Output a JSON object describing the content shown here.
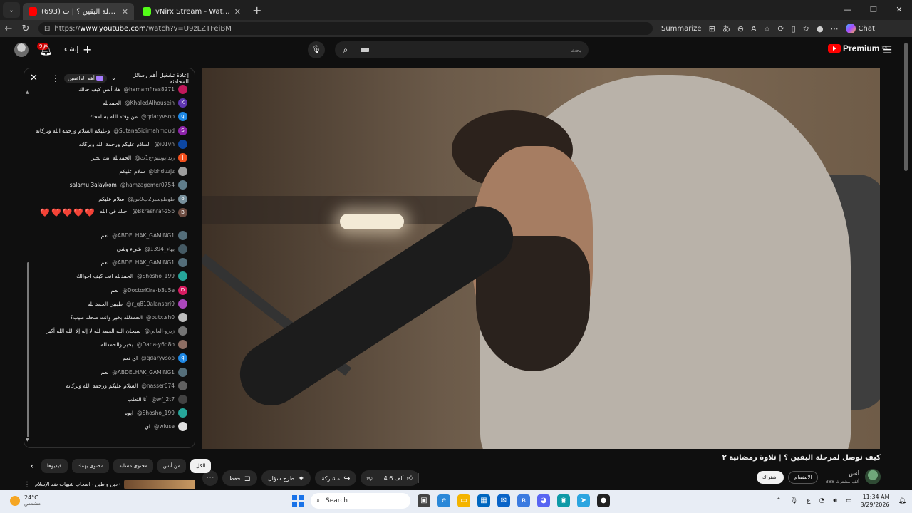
{
  "browser": {
    "tabs": [
      {
        "title": "(693) كيف توصل لمرحلة اليقين ؟ | ت",
        "favicon_color": "#ff0000",
        "active": true
      },
      {
        "title": "vNirx Stream - Watch Live on Kick",
        "favicon_color": "#53fc18",
        "active": false
      }
    ],
    "new_tab": "+",
    "url_prefix": "https://",
    "url_host": "www.youtube.com",
    "url_path": "/watch?v=U9zLZTFeiBM",
    "summarize_label": "Summarize",
    "chat_label": "Chat"
  },
  "youtube": {
    "notif_count": "9+",
    "create_label": "إنشاء",
    "search_placeholder": "بحث",
    "premium_label": "Premium",
    "region": "SA"
  },
  "chat": {
    "header_title": "إعادة تشغيل أهم رسائل المحادثة",
    "top_fans_label": "أهم الداعمين",
    "messages": [
      {
        "author": "@hamamfiras8271",
        "text": "هلا أنس كيف حالك",
        "avatar_color": "#c2185b",
        "initial": ""
      },
      {
        "author": "@KhaledAlhousein",
        "text": "الحمدلله",
        "avatar_color": "#5e35b1",
        "initial": "K"
      },
      {
        "author": "@qdaryvsop",
        "text": "من وقته الله يسامحك",
        "avatar_color": "#1e88e5",
        "initial": "q"
      },
      {
        "author": "@SutanaSidimahmoud",
        "text": "وعليكم السلام ورحمة الله وبركاته",
        "avatar_color": "#8e24aa",
        "initial": "S"
      },
      {
        "author": "@i01vn",
        "text": "السلام عليكم ورحمة الله وبركاته",
        "avatar_color": "#0d47a1",
        "initial": ""
      },
      {
        "author": "@زيدابويتيم-ع1ت",
        "text": "الحمدلله انت بخير",
        "avatar_color": "#f4511e",
        "initial": "J"
      },
      {
        "author": "@bhduzjz",
        "text": "سلام عليكم",
        "avatar_color": "#9e9e9e",
        "initial": ""
      },
      {
        "author": "@hamzagemer0754",
        "text": "salamu 3alaykom",
        "avatar_color": "#607d8b",
        "initial": ""
      },
      {
        "author": "@طوطوسبر2ب9س",
        "text": "سلام عليكم",
        "avatar_color": "#78909c",
        "initial": "o"
      },
      {
        "author": "@Bkrashraf-z5b",
        "text": "احبك في الله",
        "avatar_color": "#6d4c41",
        "initial": "B",
        "hearts": "❤️❤️❤️❤️❤️"
      },
      {
        "author": "@ABDELHAK_GAMING1",
        "text": "نعم",
        "avatar_color": "#546e7a",
        "initial": ""
      },
      {
        "author": "@بهاء_1394",
        "text": "شيء وشي",
        "avatar_color": "#455a64",
        "initial": ""
      },
      {
        "author": "@ABDELHAK_GAMING1",
        "text": "نعم",
        "avatar_color": "#546e7a",
        "initial": ""
      },
      {
        "author": "@Shosho_199",
        "text": "الحمدلله انت كيف احوالك",
        "avatar_color": "#26a69a",
        "initial": ""
      },
      {
        "author": "@DoctorKira-b3u5e",
        "text": "نعم",
        "avatar_color": "#d81b60",
        "initial": "D"
      },
      {
        "author": "@r_q810alansari9",
        "text": "طيبين الحمد لله",
        "avatar_color": "#ab47bc",
        "initial": ""
      },
      {
        "author": "@outx.sh0",
        "text": "الحمدلله بخير وانت صحك طيب؟",
        "avatar_color": "#bdbdbd",
        "initial": ""
      },
      {
        "author": "@زيرو-العالي",
        "text": "سبحان الله الحمد لله لا إله إلا الله الله أكبر",
        "avatar_color": "#757575",
        "initial": ""
      },
      {
        "author": "@Dana-y6q8o",
        "text": "بخير والحمدلله",
        "avatar_color": "#8d6e63",
        "initial": ""
      },
      {
        "author": "@qdaryvsop",
        "text": "اي نعم",
        "avatar_color": "#1e88e5",
        "initial": "q"
      },
      {
        "author": "@ABDELHAK_GAMING1",
        "text": "نعم",
        "avatar_color": "#546e7a",
        "initial": ""
      },
      {
        "author": "@nasser674",
        "text": "السلام عليكم ورحمة الله وبركاته",
        "avatar_color": "#616161",
        "initial": ""
      },
      {
        "author": "@wf_2t7",
        "text": "أنا الثعلب",
        "avatar_color": "#424242",
        "initial": ""
      },
      {
        "author": "@Shosho_199",
        "text": "ايوه",
        "avatar_color": "#26a69a",
        "initial": ""
      },
      {
        "author": "@wluse",
        "text": "اي",
        "avatar_color": "#e0e0e0",
        "initial": ""
      }
    ]
  },
  "video": {
    "title": "كيف توصل لمرحلة اليقين ؟ | تلاوة رمضانية ٢",
    "channel_name": "أنس",
    "subscribers": "388 ألف مشترك",
    "join_label": "الانضمام",
    "subscribe_label": "اشتراك",
    "likes": "4.6 ألف",
    "share_label": "مشاركة",
    "ask_label": "طرح سؤال",
    "save_label": "حفظ"
  },
  "chips": {
    "items": [
      "الكل",
      "من أنس",
      "محتوى مشابه",
      "محتوى يهمك",
      "فيديوها"
    ],
    "active_index": 0
  },
  "recommendation": {
    "title": "دين و طين - أصحاب شبهات ضد الإسلام ( ",
    "thumb_text": "نقاش"
  },
  "taskbar": {
    "temperature": "24°C",
    "weather": "مشمس",
    "search_placeholder": "Search",
    "language": "ع",
    "time": "11:34 AM",
    "date": "3/29/2026"
  }
}
